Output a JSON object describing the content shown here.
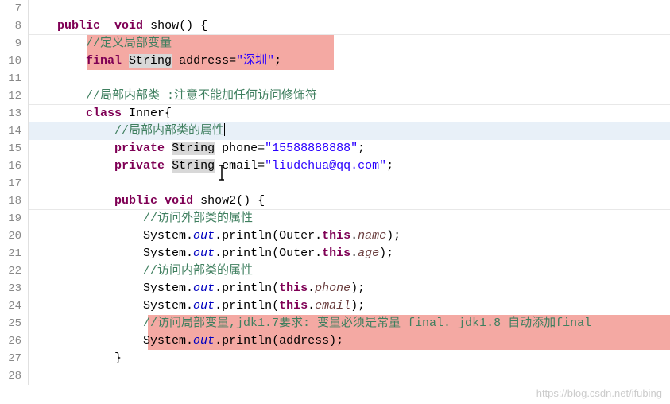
{
  "lines": {
    "start": 7,
    "end": 28
  },
  "code": {
    "l7": "",
    "l8_pad": "    ",
    "l8_kw1": "public",
    "l8_sp1": "  ",
    "l8_kw2": "void",
    "l8_sp2": " ",
    "l8_fn": "show()",
    "l8_brace": " {",
    "l9_pad": "        ",
    "l9_cmt": "//定义局部变量",
    "l10_pad": "        ",
    "l10_kw": "final",
    "l10_sp": " ",
    "l10_type": "String",
    "l10_sp2": " ",
    "l10_var": "address=",
    "l10_str": "\"深圳\"",
    "l10_semi": ";",
    "l11": "",
    "l12_pad": "        ",
    "l12_cmt": "//局部内部类 :注意不能加任何访问修饰符",
    "l13_pad": "        ",
    "l13_kw": "class",
    "l13_sp": " ",
    "l13_name": "Inner{",
    "l14_pad": "            ",
    "l14_cmt": "//局部内部类的属性",
    "l15_pad": "            ",
    "l15_kw": "private",
    "l15_sp": " ",
    "l15_type": "String",
    "l15_sp2": " ",
    "l15_var": "phone=",
    "l15_str": "\"15588888888\"",
    "l15_semi": ";",
    "l16_pad": "            ",
    "l16_kw": "private",
    "l16_sp": " ",
    "l16_type": "String",
    "l16_sp2": " ",
    "l16_var": "email=",
    "l16_str": "\"liudehua@qq.com\"",
    "l16_semi": ";",
    "l17": "",
    "l18_pad": "            ",
    "l18_kw1": "public",
    "l18_sp1": " ",
    "l18_kw2": "void",
    "l18_sp2": " ",
    "l18_fn": "show2()",
    "l18_brace": " {",
    "l19_pad": "                ",
    "l19_cmt": "//访问外部类的属性",
    "l20_pad": "                ",
    "l20_sys": "System.",
    "l20_out": "out",
    "l20_call": ".println(Outer.",
    "l20_this": "this",
    "l20_dot": ".",
    "l20_field": "name",
    "l20_end": ");",
    "l21_pad": "                ",
    "l21_sys": "System.",
    "l21_out": "out",
    "l21_call": ".println(Outer.",
    "l21_this": "this",
    "l21_dot": ".",
    "l21_field": "age",
    "l21_end": ");",
    "l22_pad": "                ",
    "l22_cmt": "//访问内部类的属性",
    "l23_pad": "                ",
    "l23_sys": "System.",
    "l23_out": "out",
    "l23_call": ".println(",
    "l23_this": "this",
    "l23_dot": ".",
    "l23_field": "phone",
    "l23_end": ");",
    "l24_pad": "                ",
    "l24_sys": "System.",
    "l24_out": "out",
    "l24_call": ".println(",
    "l24_this": "this",
    "l24_dot": ".",
    "l24_field": "email",
    "l24_end": ");",
    "l25_pad": "                ",
    "l25_cmt": "//访问局部变量,jdk1.7要求: 变量必须是常量 final. jdk1.8 自动添加final",
    "l26_pad": "                ",
    "l26_sys": "System.",
    "l26_out": "out",
    "l26_call": ".println(address);",
    "l27_pad": "            ",
    "l27_brace": "}",
    "l28": ""
  },
  "watermark": "https://blog.csdn.net/ifubing"
}
